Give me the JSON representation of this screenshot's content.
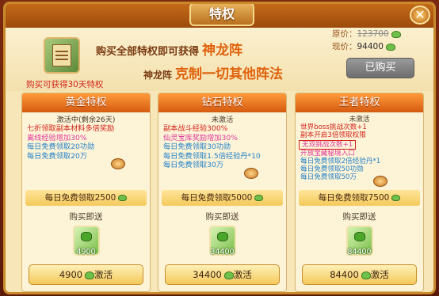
{
  "title": "特权",
  "header": {
    "headline_text": "购买全部特权即可获得",
    "headline_em": "神龙阵",
    "subline_prefix": "神龙阵",
    "subline_em": "克制一切其他阵法",
    "month_note": "购买可获得30天特权",
    "original_price_label": "原价：",
    "original_price": "123700",
    "current_price_label": "现价：",
    "current_price": "94400",
    "bought_label": "已购买"
  },
  "cards": [
    {
      "title": "黄金特权",
      "status": "激活中(剩余26天)",
      "perks": [
        {
          "text": "七折领取副本材料多倍奖励",
          "color": "red"
        },
        {
          "text": "离线经验增加30%",
          "color": "pink"
        },
        {
          "text": "每日免费领取20功勋",
          "color": "blue"
        },
        {
          "text": "每日免费领取20万",
          "color": "blue"
        }
      ],
      "daily": "每日免费领取2500",
      "buy_send": "购买即送",
      "gift_amount": "4900",
      "activate_amount": "4900",
      "activate_label": "激活"
    },
    {
      "title": "钻石特权",
      "status": "未激活",
      "perks": [
        {
          "text": "副本战斗经验300%",
          "color": "red"
        },
        {
          "text": "仙灵宝库奖励增加30%",
          "color": "pink"
        },
        {
          "text": "每日免费领取30功勋",
          "color": "blue"
        },
        {
          "text": "每日免费领取1.5倍经验丹*10",
          "color": "blue"
        },
        {
          "text": "每日免费领取30万",
          "color": "blue"
        }
      ],
      "daily": "每日免费领取5000",
      "buy_send": "购买即送",
      "gift_amount": "34400",
      "activate_amount": "34400",
      "activate_label": "激活"
    },
    {
      "title": "王者特权",
      "status": "未激活",
      "perks": [
        {
          "text": "世界boss挑战次数+1",
          "color": "red"
        },
        {
          "text": "副本开启3倍领取权限",
          "color": "red"
        },
        {
          "text": "无双挑战次数+1",
          "color": "pink"
        },
        {
          "text": "开放宝藏秘境入口",
          "color": "pink"
        },
        {
          "text": "每日免费领取2倍经验丹*1",
          "color": "blue"
        },
        {
          "text": "每日免费领取50功勋",
          "color": "blue"
        },
        {
          "text": "每日免费领取50万",
          "color": "blue"
        }
      ],
      "daily": "每日免费领取7500",
      "buy_send": "购买即送",
      "gift_amount": "84400",
      "activate_amount": "84400",
      "activate_label": "激活"
    }
  ]
}
